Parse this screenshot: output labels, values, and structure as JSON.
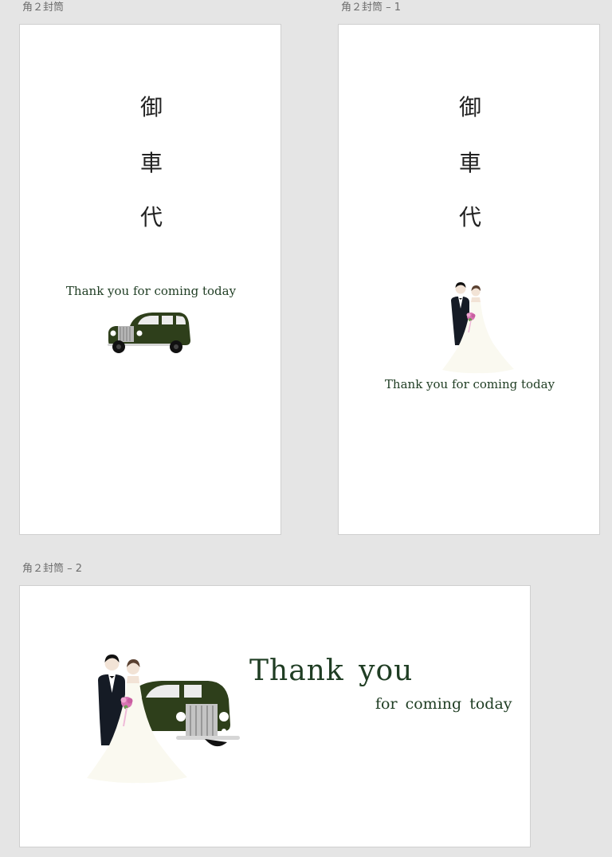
{
  "artboards": [
    {
      "label": "角２封筒",
      "vertical_text": [
        "御",
        "車",
        "代"
      ],
      "message": "Thank you for coming today"
    },
    {
      "label": "角２封筒 – 1",
      "vertical_text": [
        "御",
        "車",
        "代"
      ],
      "message": "Thank you for coming today"
    },
    {
      "label": "角２封筒 – 2",
      "message_main": "Thank  you",
      "message_sub": "for  coming  today"
    }
  ],
  "colors": {
    "canvas": "#e5e5e5",
    "artboard": "#ffffff",
    "text_green": "#1f3d23",
    "car_green": "#2e3f1b",
    "dress": "#faf9f0"
  },
  "icons": [
    "vintage-car-illustration",
    "wedding-couple-illustration"
  ]
}
